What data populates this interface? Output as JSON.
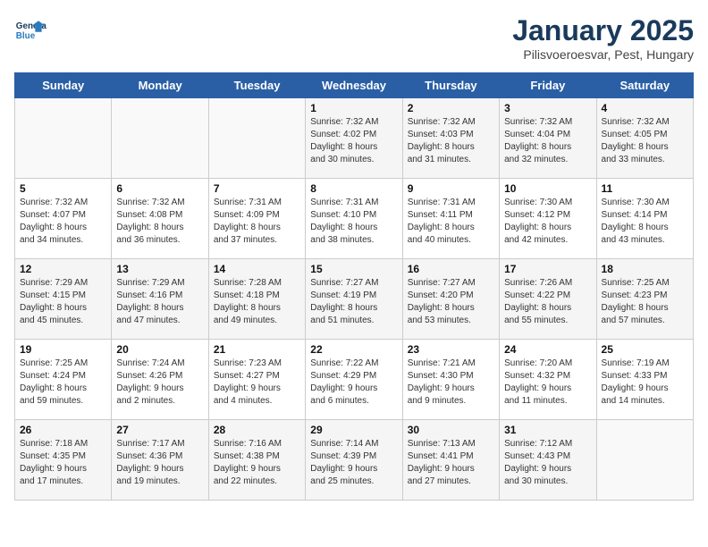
{
  "header": {
    "logo_line1": "General",
    "logo_line2": "Blue",
    "title": "January 2025",
    "subtitle": "Pilisvoeroesvar, Pest, Hungary"
  },
  "days_of_week": [
    "Sunday",
    "Monday",
    "Tuesday",
    "Wednesday",
    "Thursday",
    "Friday",
    "Saturday"
  ],
  "weeks": [
    [
      {
        "day": "",
        "info": ""
      },
      {
        "day": "",
        "info": ""
      },
      {
        "day": "",
        "info": ""
      },
      {
        "day": "1",
        "info": "Sunrise: 7:32 AM\nSunset: 4:02 PM\nDaylight: 8 hours\nand 30 minutes."
      },
      {
        "day": "2",
        "info": "Sunrise: 7:32 AM\nSunset: 4:03 PM\nDaylight: 8 hours\nand 31 minutes."
      },
      {
        "day": "3",
        "info": "Sunrise: 7:32 AM\nSunset: 4:04 PM\nDaylight: 8 hours\nand 32 minutes."
      },
      {
        "day": "4",
        "info": "Sunrise: 7:32 AM\nSunset: 4:05 PM\nDaylight: 8 hours\nand 33 minutes."
      }
    ],
    [
      {
        "day": "5",
        "info": "Sunrise: 7:32 AM\nSunset: 4:07 PM\nDaylight: 8 hours\nand 34 minutes."
      },
      {
        "day": "6",
        "info": "Sunrise: 7:32 AM\nSunset: 4:08 PM\nDaylight: 8 hours\nand 36 minutes."
      },
      {
        "day": "7",
        "info": "Sunrise: 7:31 AM\nSunset: 4:09 PM\nDaylight: 8 hours\nand 37 minutes."
      },
      {
        "day": "8",
        "info": "Sunrise: 7:31 AM\nSunset: 4:10 PM\nDaylight: 8 hours\nand 38 minutes."
      },
      {
        "day": "9",
        "info": "Sunrise: 7:31 AM\nSunset: 4:11 PM\nDaylight: 8 hours\nand 40 minutes."
      },
      {
        "day": "10",
        "info": "Sunrise: 7:30 AM\nSunset: 4:12 PM\nDaylight: 8 hours\nand 42 minutes."
      },
      {
        "day": "11",
        "info": "Sunrise: 7:30 AM\nSunset: 4:14 PM\nDaylight: 8 hours\nand 43 minutes."
      }
    ],
    [
      {
        "day": "12",
        "info": "Sunrise: 7:29 AM\nSunset: 4:15 PM\nDaylight: 8 hours\nand 45 minutes."
      },
      {
        "day": "13",
        "info": "Sunrise: 7:29 AM\nSunset: 4:16 PM\nDaylight: 8 hours\nand 47 minutes."
      },
      {
        "day": "14",
        "info": "Sunrise: 7:28 AM\nSunset: 4:18 PM\nDaylight: 8 hours\nand 49 minutes."
      },
      {
        "day": "15",
        "info": "Sunrise: 7:27 AM\nSunset: 4:19 PM\nDaylight: 8 hours\nand 51 minutes."
      },
      {
        "day": "16",
        "info": "Sunrise: 7:27 AM\nSunset: 4:20 PM\nDaylight: 8 hours\nand 53 minutes."
      },
      {
        "day": "17",
        "info": "Sunrise: 7:26 AM\nSunset: 4:22 PM\nDaylight: 8 hours\nand 55 minutes."
      },
      {
        "day": "18",
        "info": "Sunrise: 7:25 AM\nSunset: 4:23 PM\nDaylight: 8 hours\nand 57 minutes."
      }
    ],
    [
      {
        "day": "19",
        "info": "Sunrise: 7:25 AM\nSunset: 4:24 PM\nDaylight: 8 hours\nand 59 minutes."
      },
      {
        "day": "20",
        "info": "Sunrise: 7:24 AM\nSunset: 4:26 PM\nDaylight: 9 hours\nand 2 minutes."
      },
      {
        "day": "21",
        "info": "Sunrise: 7:23 AM\nSunset: 4:27 PM\nDaylight: 9 hours\nand 4 minutes."
      },
      {
        "day": "22",
        "info": "Sunrise: 7:22 AM\nSunset: 4:29 PM\nDaylight: 9 hours\nand 6 minutes."
      },
      {
        "day": "23",
        "info": "Sunrise: 7:21 AM\nSunset: 4:30 PM\nDaylight: 9 hours\nand 9 minutes."
      },
      {
        "day": "24",
        "info": "Sunrise: 7:20 AM\nSunset: 4:32 PM\nDaylight: 9 hours\nand 11 minutes."
      },
      {
        "day": "25",
        "info": "Sunrise: 7:19 AM\nSunset: 4:33 PM\nDaylight: 9 hours\nand 14 minutes."
      }
    ],
    [
      {
        "day": "26",
        "info": "Sunrise: 7:18 AM\nSunset: 4:35 PM\nDaylight: 9 hours\nand 17 minutes."
      },
      {
        "day": "27",
        "info": "Sunrise: 7:17 AM\nSunset: 4:36 PM\nDaylight: 9 hours\nand 19 minutes."
      },
      {
        "day": "28",
        "info": "Sunrise: 7:16 AM\nSunset: 4:38 PM\nDaylight: 9 hours\nand 22 minutes."
      },
      {
        "day": "29",
        "info": "Sunrise: 7:14 AM\nSunset: 4:39 PM\nDaylight: 9 hours\nand 25 minutes."
      },
      {
        "day": "30",
        "info": "Sunrise: 7:13 AM\nSunset: 4:41 PM\nDaylight: 9 hours\nand 27 minutes."
      },
      {
        "day": "31",
        "info": "Sunrise: 7:12 AM\nSunset: 4:43 PM\nDaylight: 9 hours\nand 30 minutes."
      },
      {
        "day": "",
        "info": ""
      }
    ]
  ]
}
